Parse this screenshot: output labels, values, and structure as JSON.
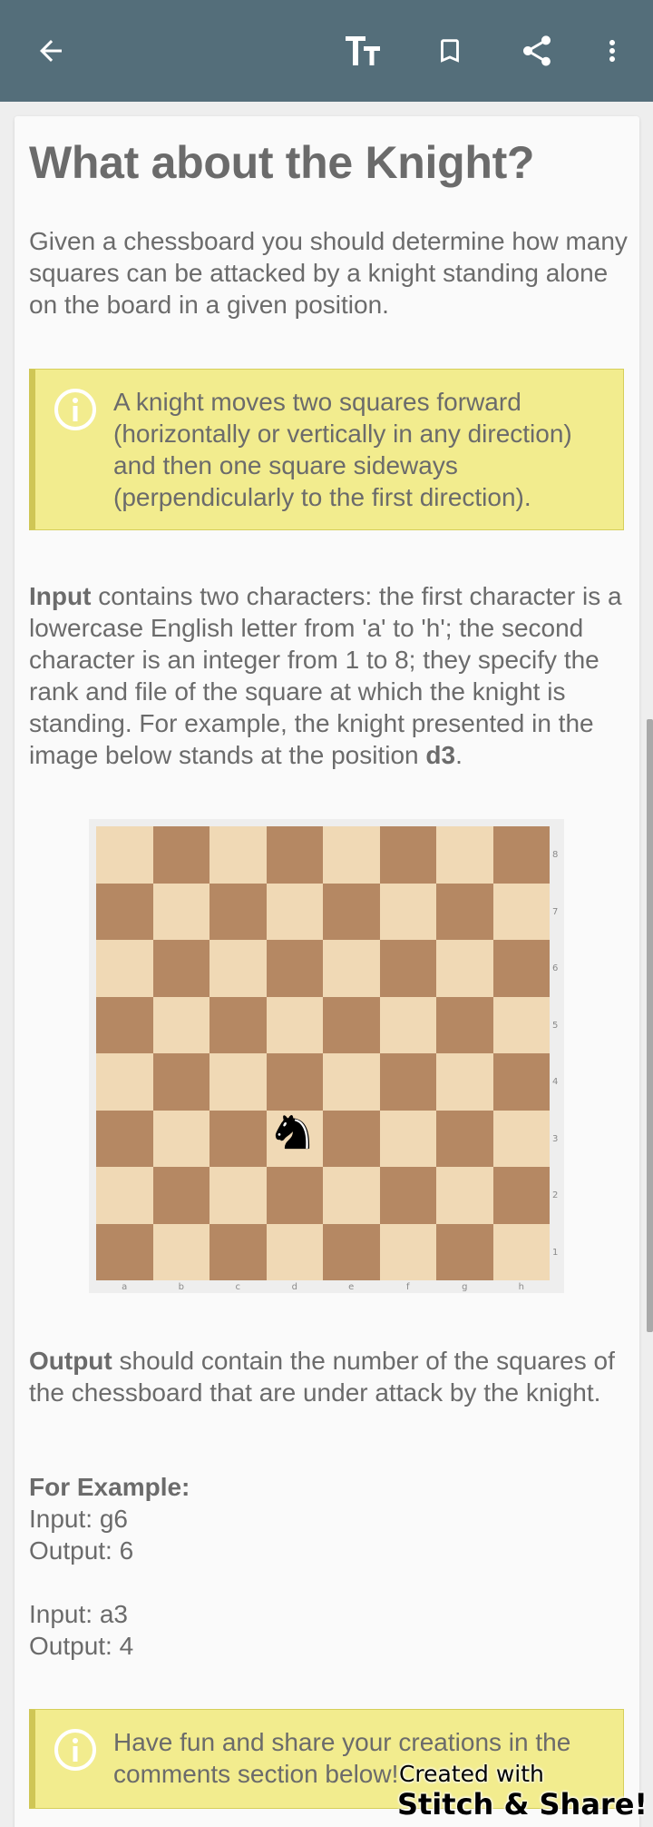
{
  "toolbar": {
    "back_icon": "arrow-back-icon",
    "text_size_icon": "text-size-icon",
    "bookmark_icon": "bookmark-icon",
    "share_icon": "share-icon",
    "more_icon": "more-vert-icon",
    "bar_color": "#546e7a"
  },
  "article": {
    "title": "What about the Knight?",
    "intro": "Given a chessboard you should determine how many squares can be attacked by a knight standing alone on the board in a given position.",
    "note1": "A knight moves two squares forward (horizontally or vertically in any direction) and then one square sideways (perpendicularly to the first direction).",
    "input_label": "Input",
    "input_text_a": " contains two characters: the first character is a lowercase English letter from 'a' to 'h'; the second character is an integer from 1 to 8; they specify the rank and file of the square at which the knight is standing. For example, the knight presented in the image below stands at the position ",
    "input_pos": "d3",
    "input_text_b": ".",
    "output_label": "Output",
    "output_text": " should contain the number of the squares of the chessboard that are under attack by the knight.",
    "example_heading": "For Example:",
    "ex1_input": "Input: g6",
    "ex1_output": "Output: 6",
    "ex2_input": "Input: a3",
    "ex2_output": "Output: 4",
    "note2": "Have fun and share your creations in the comments section below!",
    "note_color": "#f2ec8e"
  },
  "board": {
    "ranks": [
      "8",
      "7",
      "6",
      "5",
      "4",
      "3",
      "2",
      "1"
    ],
    "files": [
      "a",
      "b",
      "c",
      "d",
      "e",
      "f",
      "g",
      "h"
    ],
    "knight_square": "d3",
    "light_color": "#f0d9b5",
    "dark_color": "#b58863"
  },
  "watermark": {
    "line1": "Created with",
    "line2": "Stitch & Share!"
  }
}
